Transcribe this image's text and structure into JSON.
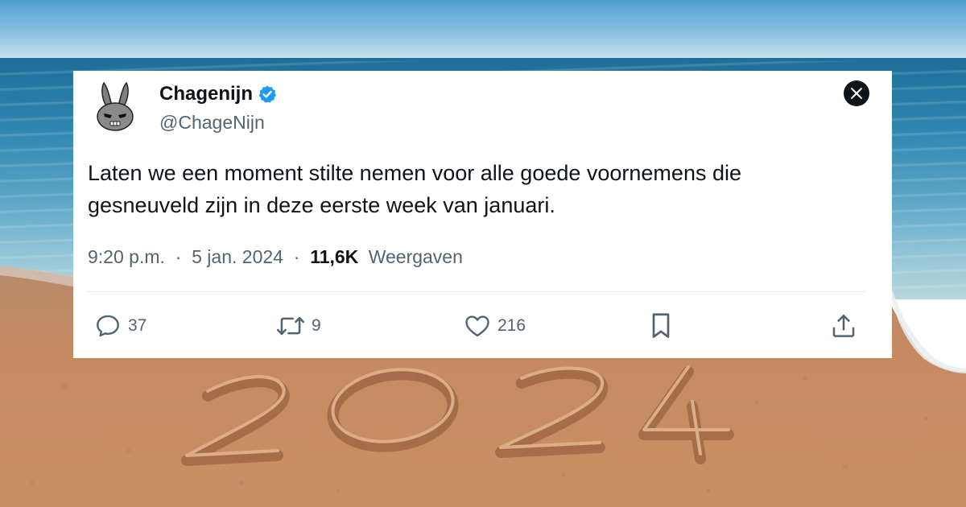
{
  "tweet": {
    "display_name": "Chagenijn",
    "handle": "@ChageNijn",
    "verified": true,
    "text_lines": [
      "Laten we een moment stilte nemen voor alle goede voornemens die",
      "gesneuveld zijn in deze eerste week van januari."
    ],
    "time": "9:20 p.m.",
    "date": "5 jan. 2024",
    "separator": "·",
    "views_count": "11,6K",
    "views_label": "Weergaven"
  },
  "actions": {
    "replies": "37",
    "retweets": "9",
    "likes": "216"
  },
  "background": {
    "sand_text": "2024"
  },
  "colors": {
    "verified_blue": "#1d9bf0",
    "text_primary": "#0f1419",
    "text_secondary": "#536471",
    "sand": "#c0825a"
  },
  "icons": [
    "verified-icon",
    "x-logo-icon",
    "reply-icon",
    "retweet-icon",
    "like-icon",
    "bookmark-icon",
    "share-icon"
  ]
}
